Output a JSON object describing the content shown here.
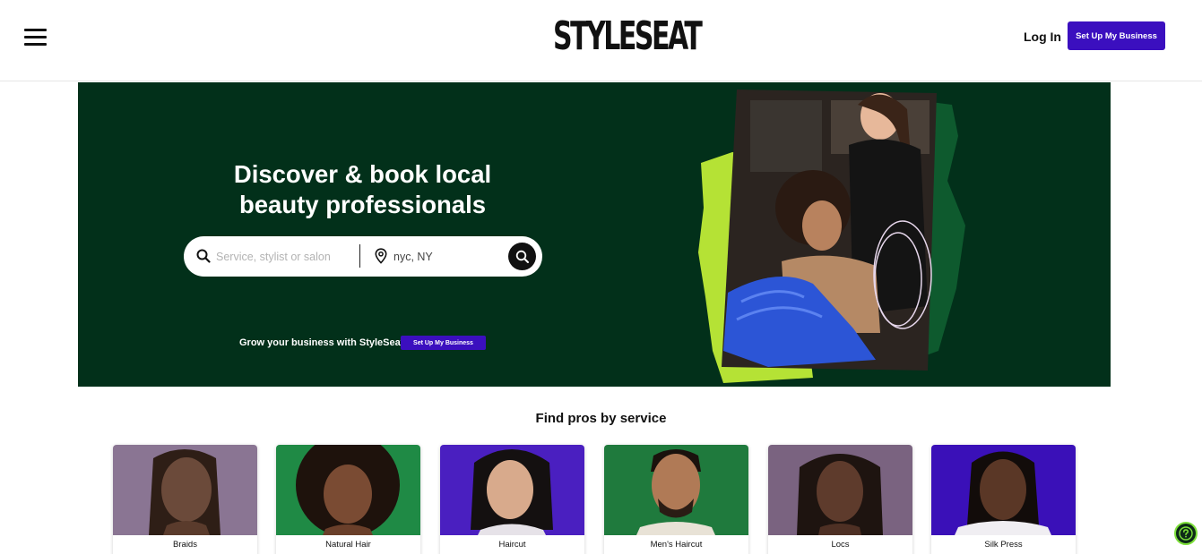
{
  "header": {
    "logo_text": "STYLESEAT",
    "login_label": "Log In",
    "setup_label": "Set Up My Business"
  },
  "hero": {
    "title": "Discover & book local beauty professionals",
    "search": {
      "service_placeholder": "Service, stylist or salon",
      "location_value": "nyc, NY"
    },
    "grow_text": "Grow your business with StyleSeat",
    "grow_button_label": "Set Up My Business"
  },
  "services": {
    "title": "Find pros by service",
    "items": [
      {
        "label": "Braids",
        "bg": "#8a7593",
        "skin": "#6b4a3a"
      },
      {
        "label": "Natural Hair",
        "bg": "#1f8a45",
        "skin": "#7a4b33"
      },
      {
        "label": "Haircut",
        "bg": "#4a1fc0",
        "skin": "#d8aa8c"
      },
      {
        "label": "Men's Haircut",
        "bg": "#1f7a3d",
        "skin": "#b07a56"
      },
      {
        "label": "Locs",
        "bg": "#7a6380",
        "skin": "#5e3b2c"
      },
      {
        "label": "Silk Press",
        "bg": "#3a10b8",
        "skin": "#5a3726"
      }
    ]
  },
  "colors": {
    "brand_purple": "#3b0fbf",
    "hero_green": "#02301a",
    "accent_lime": "#b5e235"
  },
  "icons": {
    "menu": "hamburger-icon",
    "search": "search-icon",
    "location": "map-pin-icon",
    "help": "help-icon"
  }
}
